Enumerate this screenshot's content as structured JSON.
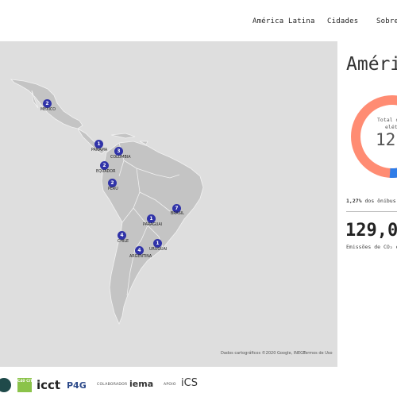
{
  "nav": {
    "items": [
      "América Latina",
      "Cidades",
      "Sobre"
    ]
  },
  "map": {
    "attribution": "Dados cartográficos ©2020 Google, INEGI",
    "terms": "Termos de Uso",
    "markers": [
      {
        "count": "2",
        "country": "MEXICO"
      },
      {
        "count": "1",
        "country": "PANAMA"
      },
      {
        "count": "3",
        "country": "COLOMBIA"
      },
      {
        "count": "2",
        "country": "EQUADOR"
      },
      {
        "count": "2",
        "country": "PERU"
      },
      {
        "count": "7",
        "country": "BRASIL"
      },
      {
        "count": "1",
        "country": "PARAGUAI"
      },
      {
        "count": "4",
        "country": "CHILE"
      },
      {
        "count": "1",
        "country": "URUGUAI"
      },
      {
        "count": "4",
        "country": "ARGENTINA"
      }
    ],
    "land_color": "#c4c4c4",
    "marker_color": "#3033a8"
  },
  "panel": {
    "title": "Améri",
    "donut_label_line1": "Total d",
    "donut_label_line2": "elét",
    "donut_value": "12",
    "donut_colors": {
      "main": "#ff8c73",
      "accent": "#2f7de8"
    },
    "electric_share_fraction": 0.0127,
    "small_stat_bold": "1,27%",
    "small_stat_text": " dos ônibus",
    "big_stat": "129,0",
    "big_stat_label": "Emissões de CO₂ e"
  },
  "footer": {
    "logos": [
      "C40 CITIES",
      "icct",
      "P4G",
      "COLABORADOR",
      "iema",
      "APOIO",
      "iCS"
    ]
  }
}
